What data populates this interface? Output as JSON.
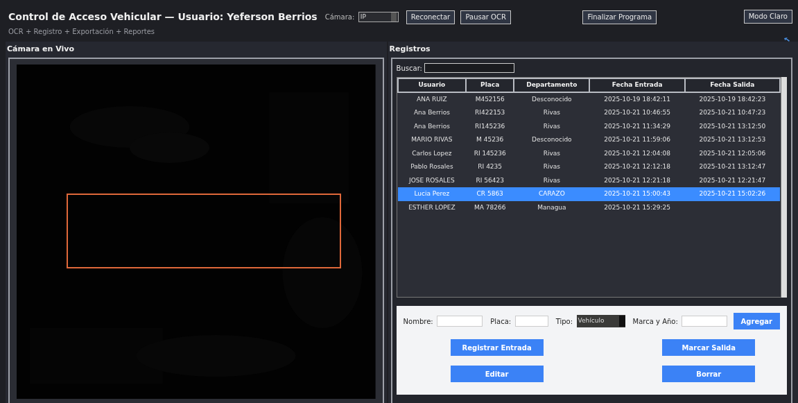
{
  "header": {
    "title": "Control de Acceso Vehicular — Usuario: Yeferson Berrios",
    "subtitle": "OCR + Registro + Exportación + Reportes",
    "camera_label": "Cámara:",
    "camera_value": "IP",
    "buttons": [
      "Reconectar",
      "Pausar OCR",
      "Finalizar Programa",
      "Modo Claro"
    ]
  },
  "camera_panel": {
    "title": "Cámara en Vivo"
  },
  "records_panel": {
    "title": "Registros",
    "search_label": "Buscar:",
    "table": {
      "columns": [
        "Usuario",
        "Placa",
        "Departamento",
        "Fecha Entrada",
        "Fecha Salida"
      ],
      "rows": [
        {
          "cells": [
            "ANA RUIZ",
            "M452156",
            "Desconocido",
            "2025-10-19 18:42:11",
            "2025-10-19 18:42:23"
          ],
          "selected": false
        },
        {
          "cells": [
            "Ana Berrios",
            "RI422153",
            "Rivas",
            "2025-10-21 10:46:55",
            "2025-10-21 10:47:23"
          ],
          "selected": false
        },
        {
          "cells": [
            "Ana Berrios",
            "RI145236",
            "Rivas",
            "2025-10-21 11:34:29",
            "2025-10-21 13:12:50"
          ],
          "selected": false
        },
        {
          "cells": [
            "MARIO RIVAS",
            "M 45236",
            "Desconocido",
            "2025-10-21 11:59:06",
            "2025-10-21 13:12:53"
          ],
          "selected": false
        },
        {
          "cells": [
            "Carlos Lopez",
            "RI 145236",
            "Rivas",
            "2025-10-21 12:04:08",
            "2025-10-21 12:05:06"
          ],
          "selected": false
        },
        {
          "cells": [
            "Pablo Rosales",
            "RI 4235",
            "Rivas",
            "2025-10-21 12:12:18",
            "2025-10-21 13:12:47"
          ],
          "selected": false
        },
        {
          "cells": [
            "JOSE ROSALES",
            "RI 56423",
            "Rivas",
            "2025-10-21 12:21:18",
            "2025-10-21 12:21:47"
          ],
          "selected": false
        },
        {
          "cells": [
            "Lucia Perez",
            "CR 5863",
            "CARAZO",
            "2025-10-21 15:00:43",
            "2025-10-21 15:02:26"
          ],
          "selected": true
        },
        {
          "cells": [
            "ESTHER LOPEZ",
            "MA 78266",
            "Managua",
            "2025-10-21 15:29:25",
            ""
          ],
          "selected": false
        }
      ]
    },
    "form": {
      "fields": [
        {
          "label": "Nombre:",
          "kind": "text"
        },
        {
          "label": "Placa:",
          "kind": "text"
        },
        {
          "label": "Tipo:",
          "kind": "select",
          "value": "Vehículo"
        },
        {
          "label": "Marca y Año:",
          "kind": "text"
        }
      ],
      "add_button": "Agregar",
      "actions": [
        "Registrar Entrada",
        "Marcar Salida",
        "Editar",
        "Borrar"
      ]
    }
  }
}
